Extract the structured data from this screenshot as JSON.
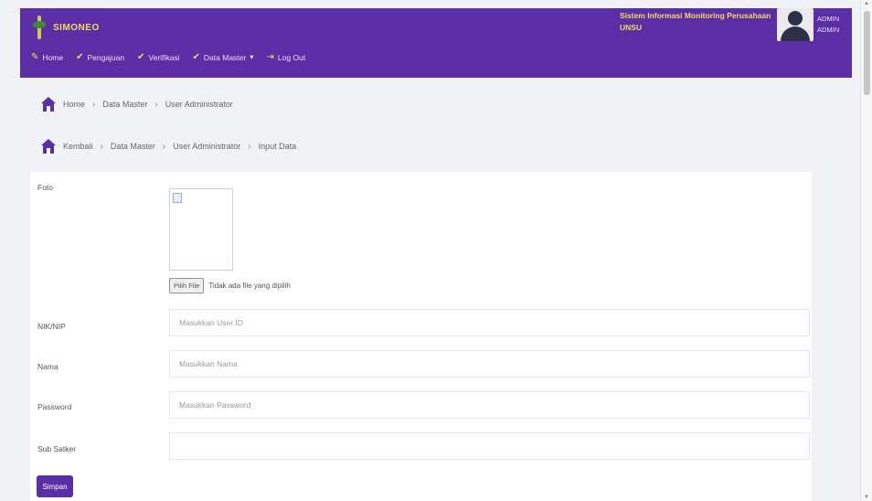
{
  "header": {
    "brand": "SIMONEO",
    "system_title": "Sistem Informasi Monitoring Perusahaan UNSU",
    "user_name": "ADMIN",
    "user_role": "ADMIN"
  },
  "menu": [
    {
      "icon": "home-icon",
      "label": "Home"
    },
    {
      "icon": "checklist-icon",
      "label": "Pengajuan"
    },
    {
      "icon": "checklist-icon",
      "label": "Verifikasi"
    },
    {
      "icon": "checklist-icon",
      "label": "Data Master"
    },
    {
      "icon": "logout-icon",
      "label": "Log Out"
    }
  ],
  "breadcrumb1": [
    "Home",
    "Data Master",
    "User Administrator"
  ],
  "breadcrumb2": [
    "Kembali",
    "Data Master",
    "User Administrator",
    "Input Data"
  ],
  "form": {
    "foto_label": "Foto",
    "file_button": "Pilih File",
    "file_status": "Tidak ada file yang dipilih",
    "nik_label": "NIK/NIP",
    "nik_placeholder": "Masukkan User ID",
    "nama_label": "Nama",
    "nama_placeholder": "Masukkan Nama",
    "password_label": "Password",
    "password_placeholder": "Masukkan Password",
    "subsatker_label": "Sub Satker",
    "subsatker_value": "",
    "save_label": "Simpan"
  },
  "colors": {
    "primary": "#5b2ea6",
    "accent": "#f2dc5d"
  }
}
